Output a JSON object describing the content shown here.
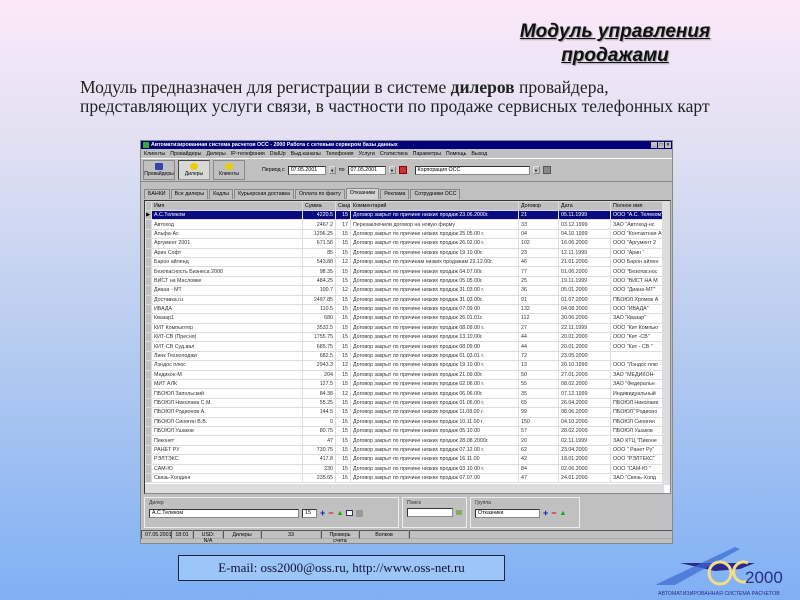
{
  "slide": {
    "title_line1": "Модуль управления",
    "title_line2": "продажами",
    "intro_before": "Модуль предназначен для регистрации в системе ",
    "intro_bold": "дилеров",
    "intro_after": " провайдера, представляющих услуги связи, в частности по продаже сервисных телефонных карт",
    "email": "E-mail: oss2000@oss.ru,  http://www.oss-net.ru",
    "logo_text": "2000",
    "logo_caption": "АВТОМАТИЗИРОВАННАЯ СИСТЕМА РАСЧЕТОВ"
  },
  "window": {
    "title": "Автоматизированная система расчетов ОСС - 2000     Работа с сетевым сервером базы данных",
    "menu": [
      "Клиенты",
      "Провайдеры",
      "Дилеры",
      "IP-телефония",
      "DialUp",
      "Выд.каналы",
      "Телефония",
      "Услуги",
      "Статистика",
      "Параметры",
      "Помощь",
      "Выход"
    ],
    "toolbar": {
      "providers": "Провайдеры",
      "dealers": "Дилеры",
      "clients": "Клиенты",
      "period_from": "Период с",
      "date_from": "07.05.2001",
      "period_to": "по",
      "date_to": "07.05.2001",
      "company": "Корпорация ОСС"
    },
    "tabs": [
      "БАНКИ",
      "Все дилеры",
      "Кадлы",
      "Курьерская доставка",
      "Оплата по факту",
      "Отказники",
      "Реклама",
      "Сотрудники ОСС"
    ],
    "active_tab": 5,
    "columns": [
      "Имя",
      "Сумма",
      "Скидка",
      "Комментарий",
      "Договор",
      "Дата",
      "Полное имя"
    ],
    "rows": [
      [
        "А.С.Телеком",
        "4220.5",
        "15",
        "Договор закрыт по причине низких продаж 23.06.2000г.",
        "21",
        "05.11.1999",
        "ООО \"А.С. Телеком\""
      ],
      [
        "Автоход",
        "2467.2",
        "17",
        "Перезаключили договор на новую фирму",
        "33",
        "03.12.1999",
        "ЗАО \"Автоход-нс"
      ],
      [
        "Альфа-Ас",
        "1296.25",
        "15",
        "Договор закрыт по причине низких продаж 25.05.00 г.",
        "04",
        "04.10.1999",
        "ООО \"Контактная А"
      ],
      [
        "Аргумент 2001",
        "671.56",
        "15",
        "Договор закрыт по причине низких продаж 26.02.00 г.",
        "102",
        "16.06.2000",
        "ООО \"Аргумент 2"
      ],
      [
        "Арин Софт",
        "85",
        "15",
        "Договор закрыт по причине низких продаж 19.10.00г.",
        "23",
        "12.11.1999",
        "ООО \"Арин \""
      ],
      [
        "Барон айленд",
        "543.88",
        "12",
        "Договор закрыт по причинам низких продажам 22.12.00г.",
        "46",
        "21.01.2000",
        "ООО Барон айлен"
      ],
      [
        "Безопасность Бизнеса 2000",
        "98.35",
        "15",
        "Договор закрыт по причине низких продаж 04.07.00г.",
        "77",
        "01.06.2000",
        "ООО \"Безопаснос"
      ],
      [
        "ВИСТ на Масловке",
        "484.25",
        "15",
        "Договор закрыт по причине низких продаж 05.05.00г.",
        "25",
        "19.11.1999",
        "ООО \"ВИСТ НА М"
      ],
      [
        "Диана - МТ",
        "100.7",
        "12",
        "Договор закрыт по причине низких продаж 31.03.00 г.",
        "36",
        "05.01.2000",
        "ООО \"Диана-МТ\""
      ],
      [
        "Доставка.ru",
        "2497.85",
        "15",
        "Договор закрыт по причине низких продаж 31.03.00г.",
        "91",
        "01.07.2000",
        "ПБОЮЛ Хромов А"
      ],
      [
        "ИВАДА",
        "110.5",
        "15",
        "Договор закрыт по причине низких продаж 07.09.00",
        "132",
        "04.08.2000",
        "ООО \"ИВАДА\""
      ],
      [
        "Квазар1",
        "680",
        "15",
        "Договор закрыт по причине низких продаж 26.01.01г.",
        "112",
        "30.06.2000",
        "ЗАО \"Квазар\""
      ],
      [
        "КИТ Компьютер",
        "3532.5",
        "15",
        "Договор закрыт по причине низких продаж 08.09.00 г.",
        "27",
        "22.11.1999",
        "ООО \"Кит Компью"
      ],
      [
        "КИТ-СВ (Пресня)",
        "1755.75",
        "15",
        "Договор закрыт по причине низких продаж 13.10.00г.",
        "44",
        "20.01.2000",
        "ООО \"Кит -СВ\""
      ],
      [
        "КИТ-СВ Суд.вал",
        "685.75",
        "15",
        "Договор закрыт по причине низких продаж 08.09.00",
        "44",
        "20.01.2000",
        "ООО \"Кит - СВ \""
      ],
      [
        "Линк Технолоджи",
        "682.5",
        "15",
        "Договор закрыт по причине низких продаж 01.03.01 г.",
        "72",
        "23.05.2000",
        ""
      ],
      [
        "Лэндос плюс",
        "2943.3",
        "12",
        "Договор закрыт по причине низких продаж 19.10.00 г.",
        "13",
        "20.10.1999",
        "ООО \"Лэндос плю"
      ],
      [
        "Медикон-М",
        "204",
        "15",
        "Договор закрыт по причине низких продаж 21.09.00г.",
        "50",
        "27.01.2000",
        "ЗАО \"МЕДИКОН-"
      ],
      [
        "МИТ АЛК",
        "127.5",
        "15",
        "Договор закрыт по причине низких продаж 02.06.00 г.",
        "55",
        "08.02.2000",
        "ЗАО \"Федеральн"
      ],
      [
        "ПБОЮЛ Запольский",
        "84.38",
        "12",
        "Договор закрыт по причине низких продаж 06.06.00г.",
        "35",
        "07.12.1999",
        "Индивидуальный"
      ],
      [
        "ПБОЮЛ Николаев С.М.",
        "55.25",
        "15",
        "Договор закрыт по причине низких продаж 01.06.00 г.",
        "65",
        "26.04.2000",
        "ПБОЮЛ Николаев"
      ],
      [
        "ПБОЮЛ Родионов А.",
        "144.5",
        "15",
        "Договор закрыт по причине низких продаж 11.08.00 г.",
        "99",
        "08.06.2000",
        "ПБОЮЛ \"Родионо"
      ],
      [
        "ПБОЮЛ Синягин В.В.",
        "0",
        "15",
        "Договор закрыт по причине низких продаж 10.11.00 г.",
        "150",
        "04.10.2000",
        "ПБОЮЛ Синягин"
      ],
      [
        "ПБОЮЛ Ушаков",
        "80.75",
        "15",
        "Договор закрыт по причине низких продаж 05.10.00",
        "57",
        "28.02.2000",
        "ПБОЮЛ Ушаков"
      ],
      [
        "Пиконет",
        "47",
        "15",
        "Договор закрыт по причине низких продаж 28.08.2000г.",
        "20",
        "02.11.1999",
        "ЗАО КТЦ \"Пиконе"
      ],
      [
        "РАНЕТ РУ",
        "730.75",
        "15",
        "Договор закрыт по причине низких продаж 07.12.00 г.",
        "62",
        "23.04.2000",
        "ООО \" Ранет Ру\""
      ],
      [
        "РЭЛТЭКС",
        "417.8",
        "15",
        "Договор закрыт по причине низких продаж 16.11.00",
        "42",
        "18.01.2000",
        "ООО \"РЭЛТЕКС\""
      ],
      [
        "САМ-Ю",
        "230",
        "15",
        "Договор закрыт по причине низких продаж 03.10.00 г.",
        "84",
        "02.06.2000",
        "ООО \"САМ-Ю \""
      ],
      [
        "Связь-Холдинг",
        "235.65",
        "15",
        "Договор  закрыт по причине низких продаж 07.07.00",
        "47",
        "24.01.2000",
        "ЗАО \"Связь-Холд"
      ]
    ],
    "bottom": {
      "dealer_label": "Дилер",
      "dealer_value": "А.С.Телеком",
      "discount_value": "15",
      "search_label": "Поиск",
      "search_value": "",
      "group_label": "Группа",
      "group_value": "Отказники"
    },
    "status": [
      "07.05.2001",
      "18:01",
      "USD: N/A",
      "Дилеры",
      "33",
      "Проверь счета",
      "Волков",
      ""
    ]
  }
}
